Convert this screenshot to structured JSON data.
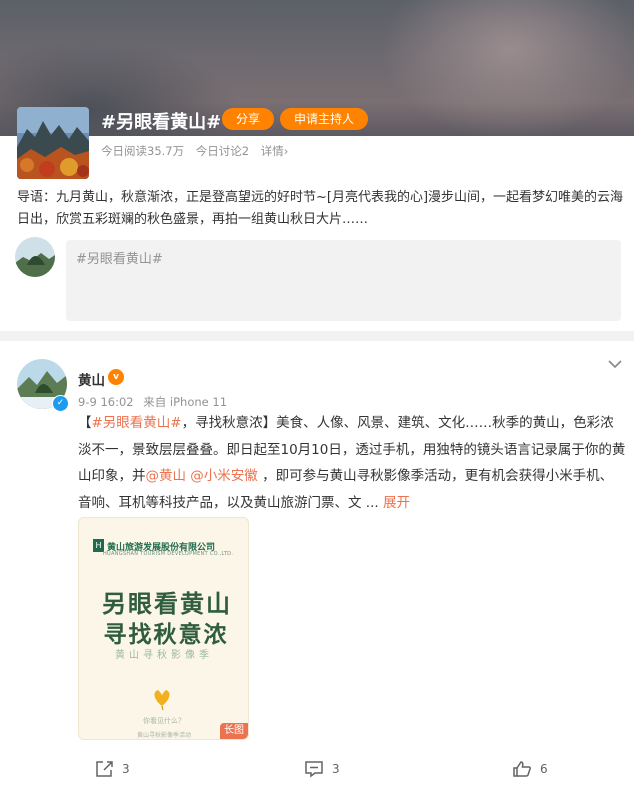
{
  "topic": {
    "title": "#另眼看黄山#",
    "share_label": "分享",
    "host_label": "申请主持人",
    "stats": {
      "reads": "今日阅读35.7万",
      "discussions": "今日讨论2",
      "details": "详情›"
    },
    "intro": "导语：九月黄山，秋意渐浓，正是登高望远的好时节~[月亮代表我的心]漫步山间，一起看梦幻唯美的云海日出，欣赏五彩斑斓的秋色盛景，再拍一组黄山秋日大片……"
  },
  "composer": {
    "placeholder": "#另眼看黄山#"
  },
  "post": {
    "author": "黄山",
    "time": "9-9 16:02",
    "source": "来自 iPhone 11",
    "text": {
      "bracket_open": "【",
      "hashtag": "#另眼看黄山#",
      "part1": "，寻找秋意浓】美食、人像、风景、建筑、文化……秋季的黄山，色彩浓淡不一，景致层层叠叠。即日起至10月10日，透过手机，用独特的镜头语言记录属于你的黄山印象，并",
      "mention1": "@黄山",
      "space": " ",
      "mention2": "@小米安徽",
      "part2": " ，即可参与黄山寻秋影像季活动，更有机会获得小米手机、音响、耳机等科技产品，以及黄山旅游门票、文 ... ",
      "expand": "展开"
    },
    "poster": {
      "org": "黄山旅游发展股份有限公司",
      "org_en": "HUANGSHAN TOURISM DEVELOPMENT CO.,LTD.",
      "line1": "另眼看黄山",
      "line2": "寻找秋意浓",
      "sub": "黄山寻秋影像季",
      "question": "你看见什么？",
      "footer": "黄山寻秋影像季活动",
      "long_tag": "长图"
    },
    "actions": {
      "reposts": "3",
      "comments": "3",
      "likes": "6"
    }
  },
  "colors": {
    "accent": "#ff8200",
    "link": "#eb7350",
    "muted": "#939393"
  }
}
